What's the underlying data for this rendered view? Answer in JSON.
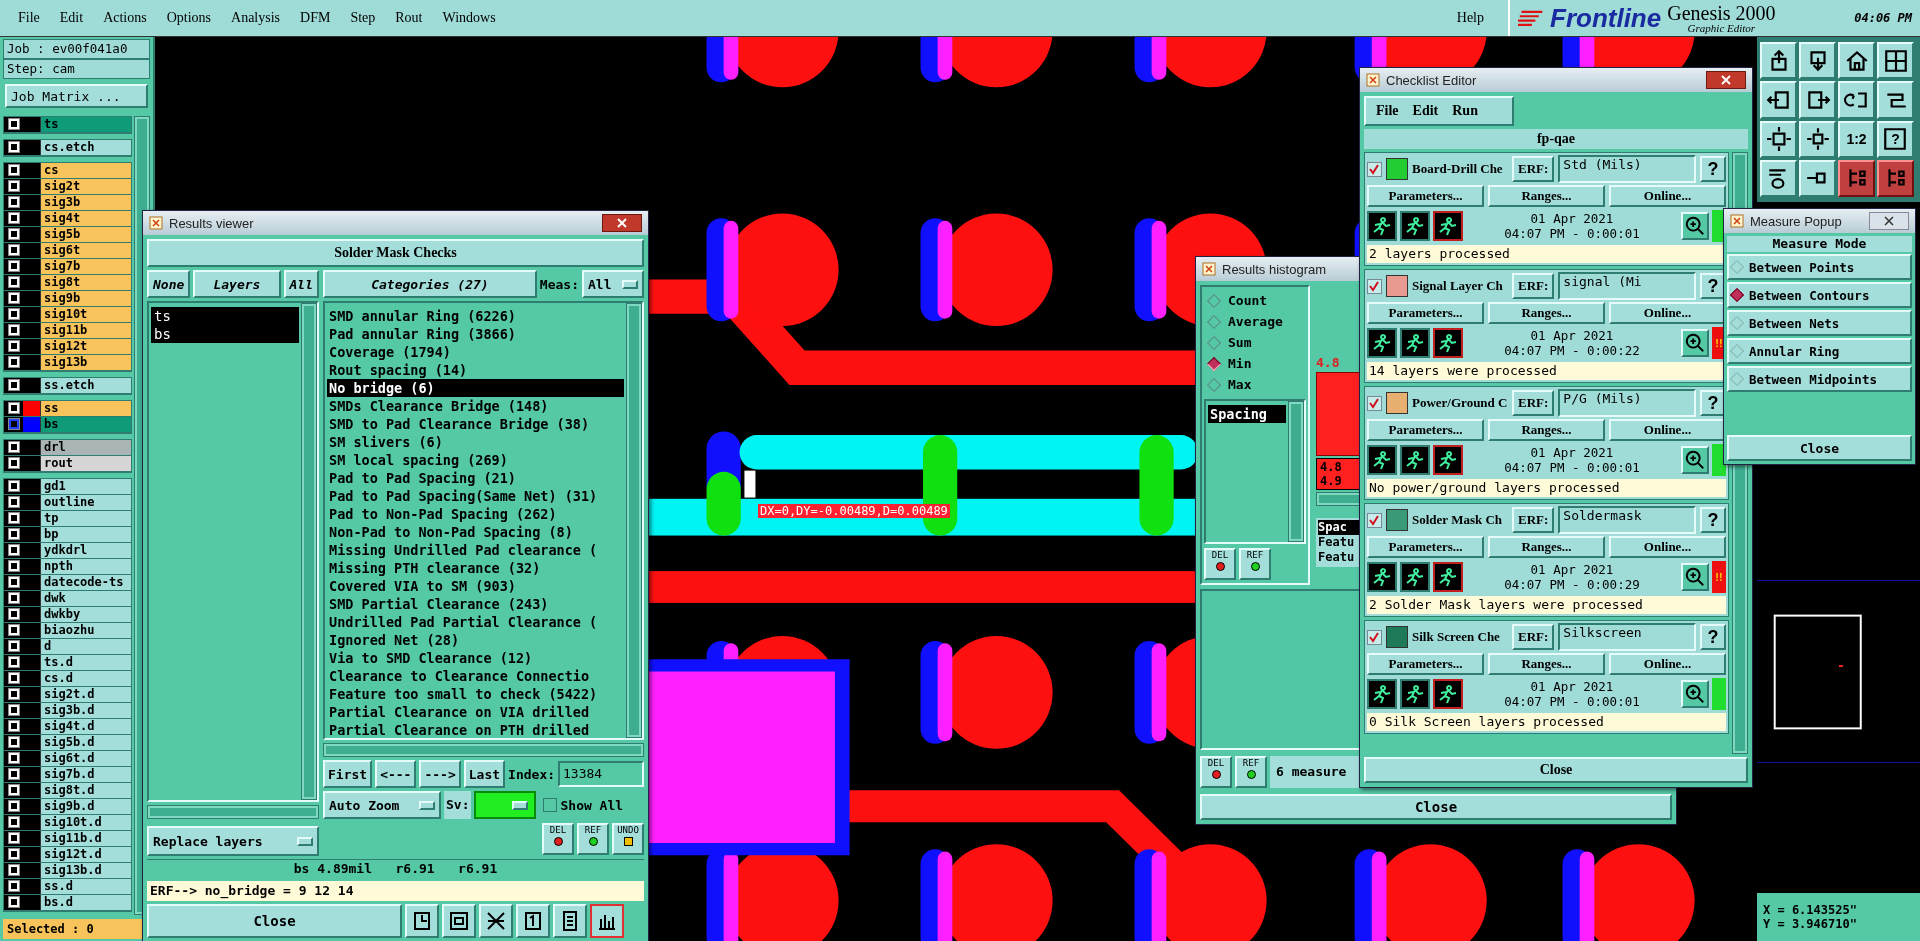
{
  "menu_bar": {
    "items": [
      "File",
      "Edit",
      "Actions",
      "Options",
      "Analysis",
      "DFM",
      "Step",
      "Rout",
      "Windows"
    ],
    "help": "Help"
  },
  "branding": {
    "logo": "Frontline",
    "product": "Genesis 2000",
    "subtitle": "Graphic Editor",
    "time": "04:06 PM"
  },
  "job_panel": {
    "job": "Job : ev00f041a0",
    "step": "Step: cam",
    "matrix_button": "Job Matrix ...",
    "selected_count": "Selected : 0",
    "layer_groups": [
      [
        {
          "name": "ts",
          "color": "#0f9a78",
          "checked": false
        }
      ],
      [
        {
          "name": "cs.etch",
          "color": "#a3dedb",
          "checked": false
        }
      ],
      [
        {
          "name": "cs",
          "color": "#f7c35a",
          "checked": false
        },
        {
          "name": "sig2t",
          "color": "#f7c35a",
          "checked": false
        },
        {
          "name": "sig3b",
          "color": "#f7c35a",
          "checked": false
        },
        {
          "name": "sig4t",
          "color": "#f7c35a",
          "checked": false
        },
        {
          "name": "sig5b",
          "color": "#f7c35a",
          "checked": false
        },
        {
          "name": "sig6t",
          "color": "#f7c35a",
          "checked": false
        },
        {
          "name": "sig7b",
          "color": "#f7c35a",
          "checked": false
        },
        {
          "name": "sig8t",
          "color": "#f7c35a",
          "checked": false
        },
        {
          "name": "sig9b",
          "color": "#f7c35a",
          "checked": false
        },
        {
          "name": "sig10t",
          "color": "#f7c35a",
          "checked": false
        },
        {
          "name": "sig11b",
          "color": "#f7c35a",
          "checked": false
        },
        {
          "name": "sig12t",
          "color": "#f7c35a",
          "checked": false
        },
        {
          "name": "sig13b",
          "color": "#f7c35a",
          "checked": false
        }
      ],
      [
        {
          "name": "ss.etch",
          "color": "#a3dedb",
          "checked": false
        }
      ],
      [
        {
          "name": "ss",
          "color": "#f7c35a",
          "checked": false,
          "swatch": {
            "color": "#ff0000"
          }
        },
        {
          "name": "bs",
          "color": "#0f9a78",
          "checked": true,
          "swatch": {
            "color": "#0000ff"
          }
        }
      ],
      [
        {
          "name": "drl",
          "color": "#a9b4b4",
          "checked": false
        },
        {
          "name": "rout",
          "color": "#d6d6d6",
          "checked": false
        }
      ],
      [
        {
          "name": "gd1",
          "color": "#a3dedb",
          "checked": false
        },
        {
          "name": "outline",
          "color": "#a3dedb",
          "checked": false
        },
        {
          "name": "tp",
          "color": "#a3dedb",
          "checked": false
        },
        {
          "name": "bp",
          "color": "#a3dedb",
          "checked": false
        },
        {
          "name": "ydkdrl",
          "color": "#a3dedb",
          "checked": false
        },
        {
          "name": "npth",
          "color": "#a3dedb",
          "checked": false
        },
        {
          "name": "datecode-ts",
          "color": "#a3dedb",
          "checked": false
        },
        {
          "name": "dwk",
          "color": "#a3dedb",
          "checked": false
        },
        {
          "name": "dwkby",
          "color": "#a3dedb",
          "checked": false
        },
        {
          "name": "biaozhu",
          "color": "#a3dedb",
          "checked": false
        },
        {
          "name": "d",
          "color": "#a3dedb",
          "checked": false
        },
        {
          "name": "ts.d",
          "color": "#a3dedb",
          "checked": false
        },
        {
          "name": "cs.d",
          "color": "#a3dedb",
          "checked": false
        },
        {
          "name": "sig2t.d",
          "color": "#a3dedb",
          "checked": false
        },
        {
          "name": "sig3b.d",
          "color": "#a3dedb",
          "checked": false
        },
        {
          "name": "sig4t.d",
          "color": "#a3dedb",
          "checked": false
        },
        {
          "name": "sig5b.d",
          "color": "#a3dedb",
          "checked": false
        },
        {
          "name": "sig6t.d",
          "color": "#a3dedb",
          "checked": false
        },
        {
          "name": "sig7b.d",
          "color": "#a3dedb",
          "checked": false
        },
        {
          "name": "sig8t.d",
          "color": "#a3dedb",
          "checked": false
        },
        {
          "name": "sig9b.d",
          "color": "#a3dedb",
          "checked": false
        },
        {
          "name": "sig10t.d",
          "color": "#a3dedb",
          "checked": false
        },
        {
          "name": "sig11b.d",
          "color": "#a3dedb",
          "checked": false
        },
        {
          "name": "sig12t.d",
          "color": "#a3dedb",
          "checked": false
        },
        {
          "name": "sig13b.d",
          "color": "#a3dedb",
          "checked": false
        },
        {
          "name": "ss.d",
          "color": "#a3dedb",
          "checked": false
        },
        {
          "name": "bs.d",
          "color": "#a3dedb",
          "checked": false
        }
      ]
    ]
  },
  "canvas": {
    "measurement": "DX=0,DY=-0.00489,D=0.00489"
  },
  "toolbar": [
    {
      "kind": "export",
      "highlighted": false
    },
    {
      "kind": "import",
      "highlighted": false
    },
    {
      "kind": "home",
      "highlighted": false
    },
    {
      "kind": "grid",
      "highlighted": false
    },
    {
      "kind": "left",
      "highlighted": false
    },
    {
      "kind": "right",
      "highlighted": false
    },
    {
      "kind": "undo",
      "highlighted": false
    },
    {
      "kind": "route",
      "highlighted": false
    },
    {
      "kind": "fit",
      "highlighted": false
    },
    {
      "kind": "center",
      "highlighted": false
    },
    {
      "kind": "ratio",
      "label": "1:2",
      "highlighted": false
    },
    {
      "kind": "help",
      "label": "?",
      "highlighted": false
    },
    {
      "kind": "tools",
      "highlighted": false
    },
    {
      "kind": "probe",
      "highlighted": false
    },
    {
      "kind": "net",
      "highlighted": true
    },
    {
      "kind": "net",
      "highlighted": true
    }
  ],
  "minimap": {
    "x": "X = 6.143525\"",
    "y": "Y = 3.946710\""
  },
  "results_viewer": {
    "title": "Results viewer",
    "heading": "Solder Mask Checks",
    "layer_buttons": [
      "None",
      "Layers",
      "All"
    ],
    "categories_button": "Categories (27)",
    "meas_label": "Meas:",
    "meas_value": "All",
    "layers": [
      {
        "name": "ts",
        "selected": true
      },
      {
        "name": "bs",
        "selected": true
      }
    ],
    "categories": [
      {
        "label": "SMD annular Ring (6226)",
        "selected": false
      },
      {
        "label": "Pad annular Ring (3866)",
        "selected": false
      },
      {
        "label": "Coverage (1794)",
        "selected": false
      },
      {
        "label": "Rout spacing (14)",
        "selected": false
      },
      {
        "label": "No bridge (6)",
        "selected": true
      },
      {
        "label": "SMDs Clearance Bridge (148)",
        "selected": false
      },
      {
        "label": "SMD to Pad Clearance Bridge (38)",
        "selected": false
      },
      {
        "label": "SM slivers (6)",
        "selected": false
      },
      {
        "label": "SM local spacing (269)",
        "selected": false
      },
      {
        "label": "Pad to Pad Spacing (21)",
        "selected": false
      },
      {
        "label": "Pad to Pad Spacing(Same Net) (31)",
        "selected": false
      },
      {
        "label": "Pad to Non-Pad Spacing (262)",
        "selected": false
      },
      {
        "label": "Non-Pad to Non-Pad Spacing (8)",
        "selected": false
      },
      {
        "label": "Missing Undrilled Pad clearance (",
        "selected": false
      },
      {
        "label": "Missing PTH clearance (32)",
        "selected": false
      },
      {
        "label": "Covered VIA to SM (903)",
        "selected": false
      },
      {
        "label": "SMD Partial Clearance (243)",
        "selected": false
      },
      {
        "label": "Undrilled Pad Partial Clearance (",
        "selected": false
      },
      {
        "label": "Ignored Net (28)",
        "selected": false
      },
      {
        "label": "Via to SMD Clearance (12)",
        "selected": false
      },
      {
        "label": "Clearance to Clearance Connectio",
        "selected": false
      },
      {
        "label": "Feature too small to check (5422)",
        "selected": false
      },
      {
        "label": "Partial Clearance on VIA drilled",
        "selected": false
      },
      {
        "label": "Partial Clearance on PTH drilled",
        "selected": false
      }
    ],
    "nav": [
      "First",
      "<---",
      "--->",
      "Last"
    ],
    "index_label": "Index:",
    "index_value": "13384",
    "zoom_mode": "Auto Zoom",
    "sv_label": "Sv:",
    "show_all": {
      "label": "Show All",
      "checked": false
    },
    "actions": [
      "DEL",
      "REF",
      "UNDO"
    ],
    "replace_mode": "Replace layers",
    "status": "bs 4.89mil   r6.91   r6.91",
    "erf": "ERF--> no_bridge = 9 12 14",
    "close": "Close"
  },
  "histogram": {
    "title": "Results histogram",
    "modes": [
      {
        "label": "Count",
        "selected": false
      },
      {
        "label": "Average",
        "selected": false
      },
      {
        "label": "Sum",
        "selected": false
      },
      {
        "label": "Min",
        "selected": true
      },
      {
        "label": "Max",
        "selected": false
      }
    ],
    "types": [
      {
        "label": "Spacing",
        "selected": true
      }
    ],
    "list_actions": [
      "DEL",
      "REF"
    ],
    "bar_label": "4.8",
    "legend": [
      "4.8",
      "4.9"
    ],
    "items": [
      {
        "label": "Spac",
        "selected": true
      },
      {
        "label": "Featu",
        "selected": false
      },
      {
        "label": "Featu",
        "selected": false
      }
    ],
    "footer_actions": [
      "DEL",
      "REF"
    ],
    "summary": "6 measure",
    "close": "Close"
  },
  "checklist": {
    "title": "Checklist Editor",
    "menu": [
      "File",
      "Edit",
      "Run"
    ],
    "name": "fp-qae",
    "actions": [
      {
        "checked": true,
        "color": "#22cc33",
        "name": "Board-Drill Che",
        "erf_label": "ERF:",
        "erf": "Std (Mils)",
        "help": "?",
        "buttons": [
          "Parameters...",
          "Ranges...",
          "Online..."
        ],
        "date": "01 Apr 2021",
        "time": "04:07 PM - 0:00:01",
        "failed": false,
        "message": "2 layers processed"
      },
      {
        "checked": true,
        "color": "#e89a90",
        "name": "Signal Layer Ch",
        "erf_label": "ERF:",
        "erf": "signal (Mi",
        "help": "?",
        "buttons": [
          "Parameters...",
          "Ranges...",
          "Online..."
        ],
        "date": "01 Apr 2021",
        "time": "04:07 PM - 0:00:22",
        "failed": true,
        "flag": "!!",
        "message": "14 layers were processed"
      },
      {
        "checked": true,
        "color": "#e8b070",
        "name": "Power/Ground C",
        "erf_label": "ERF:",
        "erf": "P/G (Mils)",
        "help": "?",
        "buttons": [
          "Parameters...",
          "Ranges...",
          "Online..."
        ],
        "date": "01 Apr 2021",
        "time": "04:07 PM - 0:00:01",
        "failed": false,
        "message": "No power/ground layers processed"
      },
      {
        "checked": true,
        "color": "#3a9a78",
        "name": "Solder Mask Ch",
        "erf_label": "ERF:",
        "erf": "Soldermask",
        "help": "?",
        "buttons": [
          "Parameters...",
          "Ranges...",
          "Online..."
        ],
        "date": "01 Apr 2021",
        "time": "04:07 PM - 0:00:29",
        "failed": true,
        "flag": "!!",
        "message": "2 Solder Mask layers were processed"
      },
      {
        "checked": true,
        "color": "#1f7a5a",
        "name": "Silk Screen Che",
        "erf_label": "ERF:",
        "erf": "Silkscreen",
        "help": "?",
        "buttons": [
          "Parameters...",
          "Ranges...",
          "Online..."
        ],
        "date": "01 Apr 2021",
        "time": "04:07 PM - 0:00:01",
        "failed": false,
        "message": "0 Silk Screen layers processed"
      }
    ],
    "close": "Close"
  },
  "measure_popup": {
    "title": "Measure Popup",
    "heading": "Measure Mode",
    "modes": [
      {
        "label": "Between Points",
        "selected": false
      },
      {
        "label": "Between Contours",
        "selected": true
      },
      {
        "label": "Between Nets",
        "selected": false
      },
      {
        "label": "Annular Ring",
        "selected": false
      },
      {
        "label": "Between Midpoints",
        "selected": false
      }
    ],
    "close": "Close"
  }
}
